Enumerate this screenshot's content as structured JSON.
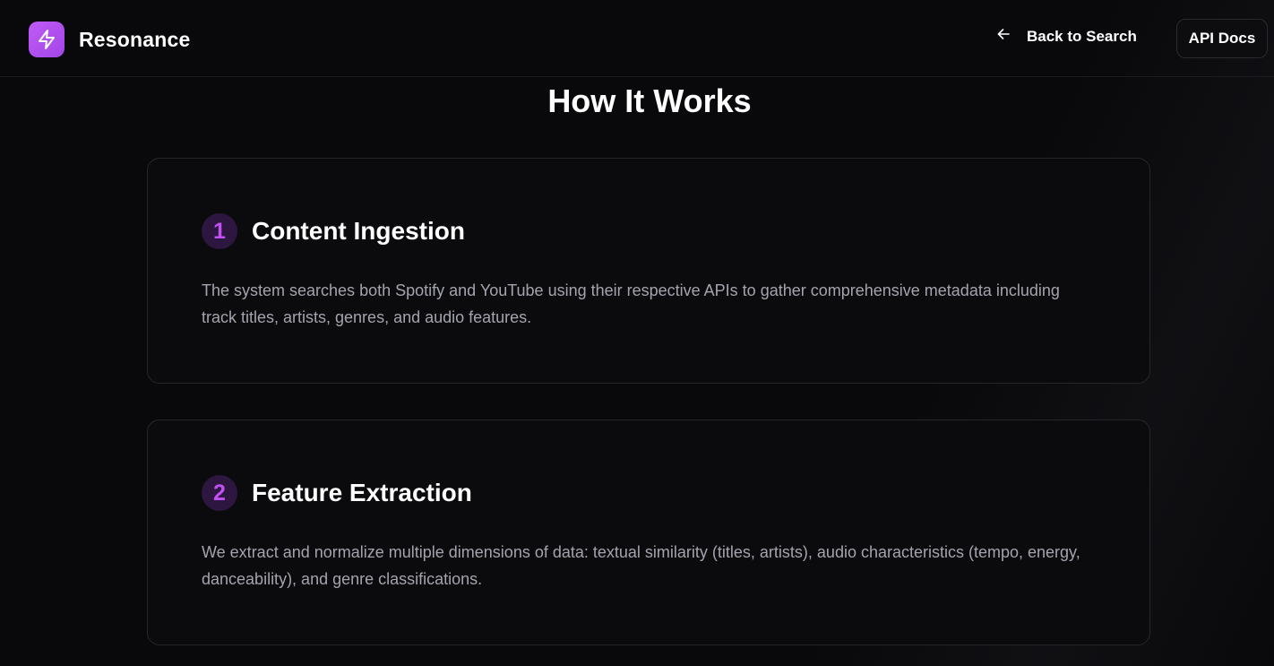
{
  "header": {
    "brand_name": "Resonance",
    "back_label": "Back to Search",
    "api_docs_label": "API Docs",
    "accent_color": "#c14ff2"
  },
  "main": {
    "title": "How It Works",
    "steps": [
      {
        "number": "1",
        "title": "Content Ingestion",
        "description": "The system searches both Spotify and YouTube using their respective APIs to gather comprehensive metadata including track titles, artists, genres, and audio features."
      },
      {
        "number": "2",
        "title": "Feature Extraction",
        "description": "We extract and normalize multiple dimensions of data: textual similarity (titles, artists), audio characteristics (tempo, energy, danceability), and genre classifications."
      }
    ]
  },
  "icons": {
    "brand_logo": "lightning-bolt-icon",
    "back": "arrow-left-icon"
  }
}
